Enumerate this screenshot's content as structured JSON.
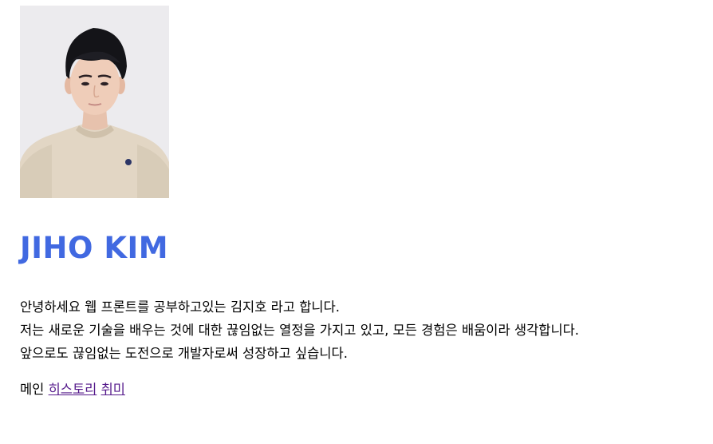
{
  "profile": {
    "name": "JIHO KIM",
    "name_color": "#4169e1"
  },
  "intro": {
    "lines": [
      "안녕하세요 웹 프론트를 공부하고있는 김지호 라고 합니다.",
      "저는 새로운 기술을 배우는 것에 대한 끊임없는 열정을 가지고 있고, 모든 경험은 배움이라 생각합니다.",
      "앞으로도 끊임없는 도전으로 개발자로써 성장하고 싶습니다."
    ]
  },
  "nav": {
    "current_label": "메인",
    "links": [
      "히스토리",
      "취미"
    ],
    "link_color": "#551a8b"
  }
}
